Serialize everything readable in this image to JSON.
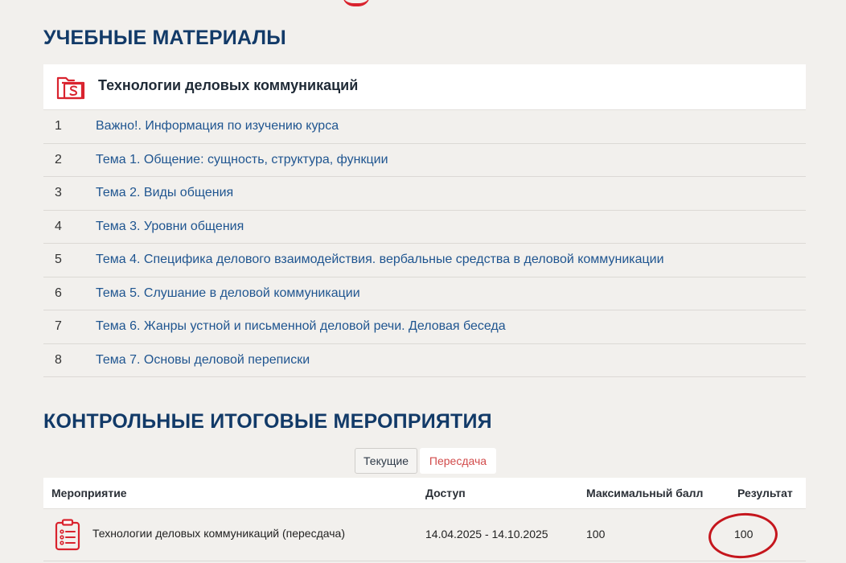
{
  "materials": {
    "title": "УЧЕБНЫЕ МАТЕРИАЛЫ",
    "course_title": "Технологии деловых коммуникаций",
    "course_icon": "folder-s-icon",
    "items": [
      {
        "num": "1",
        "label": "Важно!. Информация по изучению курса"
      },
      {
        "num": "2",
        "label": "Тема 1. Общение: сущность, структура, функции"
      },
      {
        "num": "3",
        "label": "Тема 2. Виды общения"
      },
      {
        "num": "4",
        "label": "Тема 3. Уровни общения"
      },
      {
        "num": "5",
        "label": "Тема 4. Специфика делового взаимодействия. вербальные средства в деловой коммуникации"
      },
      {
        "num": "6",
        "label": "Тема 5. Слушание в деловой коммуникации"
      },
      {
        "num": "7",
        "label": "Тема 6. Жанры устной и письменной деловой речи. Деловая беседа"
      },
      {
        "num": "8",
        "label": "Тема 7. Основы деловой переписки"
      }
    ]
  },
  "events": {
    "title": "КОНТРОЛЬНЫЕ ИТОГОВЫЕ МЕРОПРИЯТИЯ",
    "tabs": {
      "current": "Текущие",
      "retake": "Пересдача"
    },
    "columns": {
      "event": "Мероприятие",
      "access": "Доступ",
      "max_score": "Максимальный балл",
      "result": "Результат"
    },
    "rows": [
      {
        "icon": "checklist-icon",
        "event": "Технологии деловых коммуникаций (пересдача)",
        "access": "14.04.2025 - 14.10.2025",
        "max_score": "100",
        "result": "100"
      }
    ]
  },
  "colors": {
    "accent_red": "#d9232e",
    "title_blue": "#123a68",
    "link_blue": "#1f5590",
    "annotation_red": "#c5161d"
  }
}
